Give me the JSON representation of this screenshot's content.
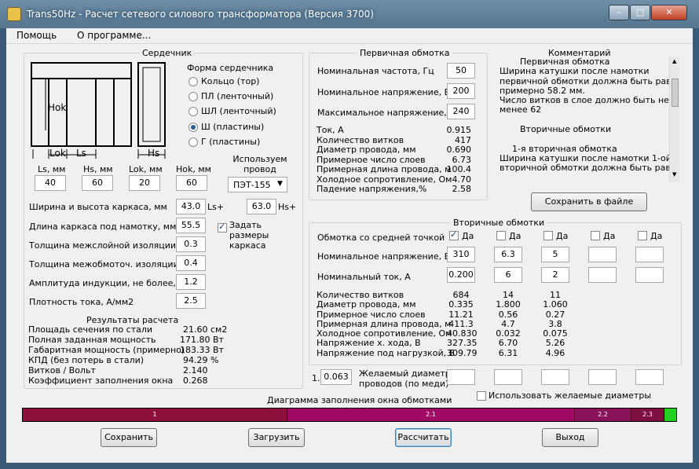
{
  "window": {
    "title": "Trans50Hz - Расчет сетевого силового трансформатора (Версия 3700)",
    "minimize": "–",
    "maximize": "□",
    "close": "✕"
  },
  "menu": {
    "help": "Помощь",
    "about": "О программе..."
  },
  "core": {
    "group_label": "Сердечник",
    "dim_hok": "Hok",
    "dim_lok": "Lok",
    "dim_ls": "Ls",
    "dim_hs": "Hs",
    "shape_label": "Форма сердечника",
    "shapes": [
      "Кольцо  (тор)",
      "ПЛ  (ленточный)",
      "ШЛ  (ленточный)",
      "Ш  (пластины)",
      "Г  (пластины)"
    ],
    "ls_label": "Ls, мм",
    "ls_value": "40",
    "hs_label": "Hs, мм",
    "hs_value": "60",
    "lok_label": "Lok, мм",
    "lok_value": "20",
    "hok_label": "Hok, мм",
    "hok_value": "60",
    "wire_label": "Используем провод",
    "wire_value": "ПЭТ-155",
    "frame_wh_label": "Ширина и высота каркаса, мм",
    "frame_w_value": "43.0",
    "frame_w_suffix": "Ls+",
    "frame_h_value": "63.0",
    "frame_h_suffix": "Hs+",
    "frame_len_label": "Длина каркаса под намотку, мм",
    "frame_len_value": "55.5",
    "set_frame_label": "Задать размеры каркаса",
    "interlayer_label": "Толщина межслойной изоляции, мм",
    "interlayer_value": "0.3",
    "interwinding_label": "Толщина межобмоточ. изоляции, мм",
    "interwinding_value": "0.4",
    "induction_label": "Амплитуда индукции, не более, Тл",
    "induction_value": "1.2",
    "current_density_label": "Плотность тока, А/мм2",
    "current_density_value": "2.5",
    "results_label": "Результаты расчета",
    "results": [
      {
        "label": "Площадь сечения по стали",
        "value": "21.60 см2"
      },
      {
        "label": "Полная заданная мощность",
        "value": "171.80 Вт"
      },
      {
        "label": "Габаритная мощность (примерно)",
        "value": "183.33 Вт"
      },
      {
        "label": "КПД (без потерь в стали)",
        "value": "94.29 %"
      },
      {
        "label": "Витков / Вольт",
        "value": "2.140"
      },
      {
        "label": "Коэффициент заполнения окна",
        "value": "0.268"
      }
    ]
  },
  "primary": {
    "group_label": "Первичная обмотка",
    "freq_label": "Номинальная частота, Гц",
    "freq_value": "50",
    "volt_label": "Номинальное напряжение, В",
    "volt_value": "200",
    "maxvolt_label": "Максимальное напряжение, В",
    "maxvolt_value": "240",
    "results": [
      {
        "label": "Ток, А",
        "value": "0.915"
      },
      {
        "label": "Количество витков",
        "value": "417"
      },
      {
        "label": "Диаметр провода, мм",
        "value": "0.690"
      },
      {
        "label": "Примерное число слоев",
        "value": "6.73"
      },
      {
        "label": "Примерная длина провода, м",
        "value": "100.4"
      },
      {
        "label": "Холодное сопротивление, Ом",
        "value": "4.70"
      },
      {
        "label": "Падение напряжения,%",
        "value": "2.58"
      }
    ]
  },
  "comment": {
    "label": "Комментарий",
    "lines": [
      "Первичная обмотка",
      "Ширина катушки после намотки",
      "первичной обмотки должна быть равна",
      "примерно 58.2 мм.",
      "Число витков в слое должно быть не",
      "менее 62",
      "",
      "Вторичные обмотки",
      "",
      "1-я вторичная обмотка",
      "Ширина катушки после намотки 1-ой",
      "вторичной обмотки должна быть равна"
    ],
    "save_button": "Сохранить в файле"
  },
  "secondary": {
    "group_label": "Вторичные обмотки",
    "center_tap_label": "Обмотка со средней точкой",
    "yes_label": "Да",
    "volt_label": "Номинальное напряжение, В",
    "current_label": "Номинальный ток, А",
    "columns": [
      {
        "center_tap": true,
        "volt": "310",
        "current": "0.200",
        "turns": "684",
        "diameter": "0.335",
        "layers": "11.21",
        "length": "411.3",
        "resistance": "40.830",
        "no_load": "327.35",
        "load": "309.79"
      },
      {
        "center_tap": false,
        "volt": "6.3",
        "current": "6",
        "turns": "14",
        "diameter": "1.800",
        "layers": "0.56",
        "length": "4.7",
        "resistance": "0.032",
        "no_load": "6.70",
        "load": "6.31"
      },
      {
        "center_tap": false,
        "volt": "5",
        "current": "2",
        "turns": "11",
        "diameter": "1.060",
        "layers": "0.27",
        "length": "3.8",
        "resistance": "0.075",
        "no_load": "5.26",
        "load": "4.96"
      },
      {
        "center_tap": false,
        "volt": "",
        "current": "",
        "turns": "",
        "diameter": "",
        "layers": "",
        "length": "",
        "resistance": "",
        "no_load": "",
        "load": ""
      },
      {
        "center_tap": false,
        "volt": "",
        "current": "",
        "turns": "",
        "diameter": "",
        "layers": "",
        "length": "",
        "resistance": "",
        "no_load": "",
        "load": ""
      }
    ],
    "row_labels": [
      "Количество витков",
      "Диаметр провода, мм",
      "Примерное число слоев",
      "Примерная длина провода, м",
      "Холодное сопротивление, Ом",
      "Напряжение х. хода, В",
      "Напряжение под нагрузкой, В"
    ],
    "desired_prefix": "1.",
    "desired_value": "0.063",
    "desired_label_1": "Желаемый диаметр",
    "desired_label_2": "проводов  (по меди)",
    "use_desired_label": "Использовать желаемые диаметры"
  },
  "fill_diagram": {
    "label": "Диаграмма заполнения окна обмотками",
    "segments": [
      {
        "label": "1",
        "fraction": 0.405,
        "color": "#8c0f3c"
      },
      {
        "label": "2.1",
        "fraction": 0.44,
        "color": "#a00a66"
      },
      {
        "label": "2.2",
        "fraction": 0.087,
        "color": "#8a1258"
      },
      {
        "label": "2.3",
        "fraction": 0.05,
        "color": "#7d1040"
      }
    ],
    "free_color": "#22d022"
  },
  "buttons": {
    "save": "Сохранить",
    "load": "Загрузить",
    "calculate": "Рассчитать",
    "exit": "Выход"
  }
}
